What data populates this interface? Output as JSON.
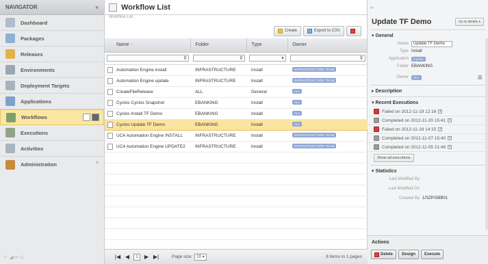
{
  "navigator": {
    "title": "NAVIGATOR",
    "collapse": "«",
    "items": [
      {
        "label": "Dashboard",
        "color": "#b0bccb"
      },
      {
        "label": "Packages",
        "color": "#8fb1d4"
      },
      {
        "label": "Releases",
        "color": "#e3b24e"
      },
      {
        "label": "Environments",
        "color": "#9aa6b3"
      },
      {
        "label": "Deployment Targets",
        "color": "#a8b2bc"
      },
      {
        "label": "Applications",
        "color": "#7fa2c9"
      },
      {
        "label": "Workflows",
        "color": "#7fa06b"
      },
      {
        "label": "Executions",
        "color": "#8ea58a"
      },
      {
        "label": "Activities",
        "color": "#a8b4c0"
      },
      {
        "label": "Administration",
        "color": "#c98a3c"
      }
    ],
    "expand_arrow": "^"
  },
  "main": {
    "title": "Workflow List",
    "breadcrumb": "Workflow List",
    "toolbar": {
      "create": "Create",
      "export": "Export to CSV"
    },
    "columns": [
      "Name",
      "Folder",
      "Type",
      "Owner"
    ],
    "filters": {
      "name": "",
      "folder": "",
      "type": "",
      "owner": ""
    },
    "rows": [
      {
        "name": "Automation Engine install",
        "folder": "INFRASTRUCTURE",
        "type": "Install",
        "owner": "INFRASTRUCTURE TEAM",
        "selected": false
      },
      {
        "name": "Automation Engine update",
        "folder": "INFRASTRUCTURE",
        "type": "Install",
        "owner": "INFRASTRUCTURE TEAM",
        "selected": false
      },
      {
        "name": "CreateFileRelease",
        "folder": "ALL",
        "type": "General",
        "owner": "ALL",
        "selected": false
      },
      {
        "name": "Cyclos Cyclos Snapshot",
        "folder": "EBANKING",
        "type": "Install",
        "owner": "ALL",
        "selected": false
      },
      {
        "name": "Cyclos Install TF Demo",
        "folder": "EBANKING",
        "type": "Install",
        "owner": "ALL",
        "selected": false
      },
      {
        "name": "Cyclos Update TF Demo",
        "folder": "EBANKING",
        "type": "Install",
        "owner": "ALL",
        "selected": true
      },
      {
        "name": "UC4 Automation Engine INSTALL",
        "folder": "INFRASTRUCTURE",
        "type": "Install",
        "owner": "INFRASTRUCTURE TEAM",
        "selected": false
      },
      {
        "name": "UC4 Automation Engine UPDATE2",
        "folder": "INFRASTRUCTURE",
        "type": "Install",
        "owner": "INFRASTRUCTURE TEAM",
        "selected": false
      }
    ],
    "pager": {
      "page": "1",
      "page_size_label": "Page size:",
      "page_size": "20",
      "count": "8 items in 1 pages"
    }
  },
  "detail": {
    "title": "Update TF Demo",
    "goto": "Go to details",
    "general_label": "General",
    "name_label": "Name",
    "name_value": "Update TF Demo",
    "type_label": "Type",
    "type_value": "Install",
    "application_label": "Application",
    "application_value": "Cyclos",
    "folder_label": "Folder",
    "folder_value": "EBANKING",
    "owner_label": "Owner",
    "owner_value": "ALL",
    "description_label": "Description",
    "recent_label": "Recent Executions",
    "executions": [
      {
        "text": "Failed on 2012-11-19 12:16",
        "status": "fail"
      },
      {
        "text": "Completed on 2012-11-20 15:41",
        "status": "ok"
      },
      {
        "text": "Failed on 2012-11-18 14:15",
        "status": "fail"
      },
      {
        "text": "Completed on 2012-11-07 15:40",
        "status": "ok"
      },
      {
        "text": "Completed on 2012-11-05 21:49",
        "status": "ok"
      }
    ],
    "show_all": "Show all executions",
    "statistics_label": "Statistics",
    "last_modified_by_label": "Last Modified By",
    "last_modified_on_label": "Last Modified On",
    "created_by_label": "Created By",
    "created_by_value": "1/SZP/SBB01",
    "actions_label": "Actions",
    "actions": {
      "delete": "Delete",
      "design": "Design",
      "execute": "Execute"
    }
  }
}
